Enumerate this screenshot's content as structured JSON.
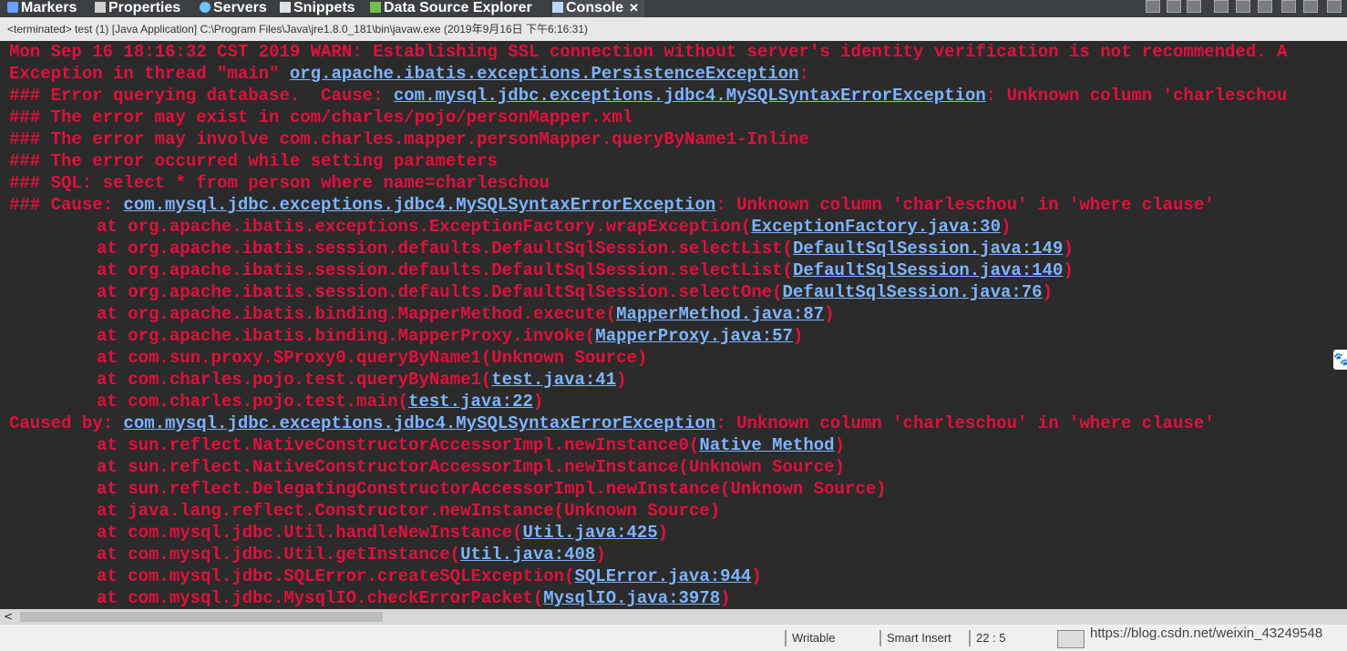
{
  "tabs": [
    {
      "label": "Markers",
      "icon": "markers-icon",
      "color": "#6aa0ff"
    },
    {
      "label": "Properties",
      "icon": "properties-icon",
      "color": "#d0d0d0"
    },
    {
      "label": "Servers",
      "icon": "servers-icon",
      "color": "#6ec3ff"
    },
    {
      "label": "Snippets",
      "icon": "snippets-icon",
      "color": "#e0e0e0"
    },
    {
      "label": "Data Source Explorer",
      "icon": "data-source-icon",
      "color": "#6fbf4a"
    },
    {
      "label": "Console",
      "icon": "console-icon",
      "color": "#bcd6ff",
      "close": "✕"
    }
  ],
  "info": "<terminated> test (1) [Java Application] C:\\Program Files\\Java\\jre1.8.0_181\\bin\\javaw.exe (2019年9月16日 下午6:16:31)",
  "console": {
    "text_color": "#e0103c",
    "link_color": "#7fb4ff",
    "lines": [
      {
        "t": "Mon Sep 16 18:16:32 CST 2019 WARN: Establishing SSL connection without server's identity verification is not recommended. A"
      },
      {
        "t": "Exception in thread \"main\" ",
        "link": "org.apache.ibatis.exceptions.PersistenceException",
        "after": ":"
      },
      {
        "t": "### Error querying database.  Cause: ",
        "link": "com.mysql.jdbc.exceptions.jdbc4.MySQLSyntaxErrorException",
        "after": ": Unknown column 'charleschou"
      },
      {
        "t": "### The error may exist in com/charles/pojo/personMapper.xml"
      },
      {
        "t": "### The error may involve com.charles.mapper.personMapper.queryByName1-Inline"
      },
      {
        "t": "### The error occurred while setting parameters"
      },
      {
        "t": "### SQL: select * from person where name=charleschou"
      },
      {
        "t": "### Cause: ",
        "link": "com.mysql.jdbc.exceptions.jdbc4.MySQLSyntaxErrorException",
        "after": ": Unknown column 'charleschou' in 'where clause'"
      },
      {
        "st": true,
        "t": "at org.apache.ibatis.exceptions.ExceptionFactory.wrapException(",
        "link": "ExceptionFactory.java:30",
        "after": ")"
      },
      {
        "st": true,
        "t": "at org.apache.ibatis.session.defaults.DefaultSqlSession.selectList(",
        "link": "DefaultSqlSession.java:149",
        "after": ")"
      },
      {
        "st": true,
        "t": "at org.apache.ibatis.session.defaults.DefaultSqlSession.selectList(",
        "link": "DefaultSqlSession.java:140",
        "after": ")"
      },
      {
        "st": true,
        "t": "at org.apache.ibatis.session.defaults.DefaultSqlSession.selectOne(",
        "link": "DefaultSqlSession.java:76",
        "after": ")"
      },
      {
        "st": true,
        "t": "at org.apache.ibatis.binding.MapperMethod.execute(",
        "link": "MapperMethod.java:87",
        "after": ")"
      },
      {
        "st": true,
        "t": "at org.apache.ibatis.binding.MapperProxy.invoke(",
        "link": "MapperProxy.java:57",
        "after": ")"
      },
      {
        "st": true,
        "t": "at com.sun.proxy.$Proxy0.queryByName1(Unknown Source)"
      },
      {
        "st": true,
        "t": "at com.charles.pojo.test.queryByName1(",
        "link": "test.java:41",
        "after": ")"
      },
      {
        "st": true,
        "t": "at com.charles.pojo.test.main(",
        "link": "test.java:22",
        "after": ")"
      },
      {
        "t": "Caused by: ",
        "link": "com.mysql.jdbc.exceptions.jdbc4.MySQLSyntaxErrorException",
        "after": ": Unknown column 'charleschou' in 'where clause'"
      },
      {
        "st": true,
        "t": "at sun.reflect.NativeConstructorAccessorImpl.newInstance0(",
        "link": "Native Method",
        "after": ")"
      },
      {
        "st": true,
        "t": "at sun.reflect.NativeConstructorAccessorImpl.newInstance(Unknown Source)"
      },
      {
        "st": true,
        "t": "at sun.reflect.DelegatingConstructorAccessorImpl.newInstance(Unknown Source)"
      },
      {
        "st": true,
        "t": "at java.lang.reflect.Constructor.newInstance(Unknown Source)"
      },
      {
        "st": true,
        "t": "at com.mysql.jdbc.Util.handleNewInstance(",
        "link": "Util.java:425",
        "after": ")"
      },
      {
        "st": true,
        "t": "at com.mysql.jdbc.Util.getInstance(",
        "link": "Util.java:408",
        "after": ")"
      },
      {
        "st": true,
        "t": "at com.mysql.jdbc.SQLError.createSQLException(",
        "link": "SQLError.java:944",
        "after": ")"
      },
      {
        "st": true,
        "t": "at com.mysql.jdbc.MysqlIO.checkErrorPacket(",
        "link": "MysqlIO.java:3978",
        "after": ")"
      }
    ]
  },
  "scrollbar": {
    "left_arrow": "<"
  },
  "status": {
    "writable": "Writable",
    "insert_mode": "Smart Insert",
    "position": "22 : 5",
    "url": "https://blog.csdn.net/weixin_43249548"
  }
}
